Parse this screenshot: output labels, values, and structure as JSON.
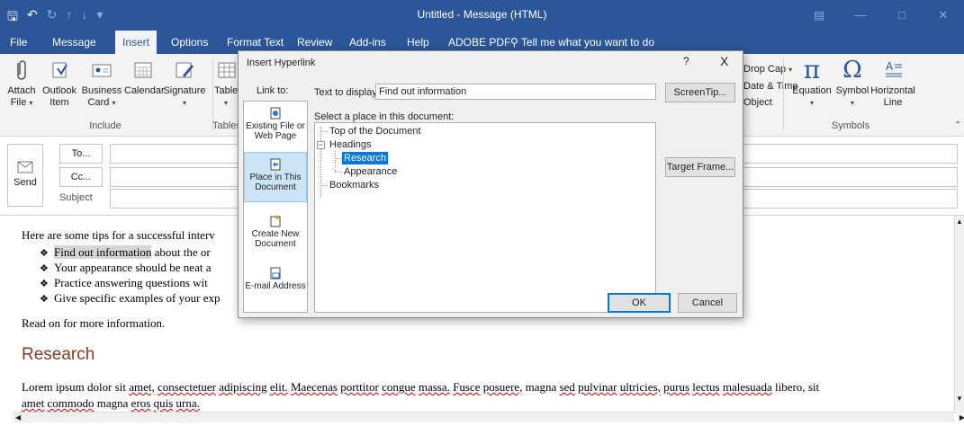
{
  "window": {
    "title": "Untitled  -  Message (HTML)",
    "qat": [
      "save-icon",
      "undo-icon",
      "redo-icon",
      "up-icon",
      "down-icon",
      "customize-icon"
    ]
  },
  "tabs": [
    "File",
    "Message",
    "Insert",
    "Options",
    "Format Text",
    "Review",
    "Add-ins",
    "Help",
    "ADOBE PDF"
  ],
  "active_tab": "Insert",
  "tell_me": "Tell me what you want to do",
  "ribbon": {
    "attach_file": "Attach\nFile",
    "outlook_item": "Outlook\nItem",
    "business_card": "Business\nCard",
    "calendar": "Calendar",
    "signature": "Signature",
    "table": "Table",
    "include_label": "Include",
    "tables_label": "Tables",
    "drop_cap": "Drop Cap",
    "date_time": "Date & Time",
    "object": "Object",
    "equation": "Equation",
    "symbol": "Symbol",
    "horizontal_line": "Horizontal\nLine",
    "symbols_label": "Symbols"
  },
  "compose": {
    "send": "Send",
    "to": "To...",
    "cc": "Cc...",
    "subject": "Subject"
  },
  "body": {
    "intro": "Here are some tips for a successful interv",
    "bullets": [
      {
        "highlight": "Find out information",
        "rest": " about the or"
      },
      {
        "highlight": "",
        "rest": "Your appearance should be neat a"
      },
      {
        "highlight": "",
        "rest": "Practice answering questions wit"
      },
      {
        "highlight": "",
        "rest": "Give specific examples of your exp"
      }
    ],
    "read_on": "Read on for more information.",
    "heading": "Research",
    "lorem_line1": "Lorem ipsum dolor sit amet, consectetuer adipiscing elit. Maecenas porttitor congue massa. Fusce posuere, magna sed pulvinar ultricies, purus lectus malesuada libero, sit",
    "lorem_line2": "amet commodo magna eros quis urna."
  },
  "dialog": {
    "title": "Insert Hyperlink",
    "help": "?",
    "close": "X",
    "link_to": "Link to:",
    "text_to_display_label": "Text to display:",
    "text_to_display_value": "Find out information",
    "screentip": "ScreenTip...",
    "select_place_label": "Select a place in this document:",
    "target_frame": "Target Frame...",
    "ok": "OK",
    "cancel": "Cancel",
    "link_options": [
      {
        "label": "Existing File or Web Page",
        "selected": false
      },
      {
        "label": "Place in This Document",
        "selected": true
      },
      {
        "label": "Create New Document",
        "selected": false
      },
      {
        "label": "E-mail Address",
        "selected": false
      }
    ],
    "tree": {
      "top": "Top of the Document",
      "headings": "Headings",
      "research": "Research",
      "appearance": "Appearance",
      "bookmarks": "Bookmarks",
      "selected": "Research"
    }
  }
}
